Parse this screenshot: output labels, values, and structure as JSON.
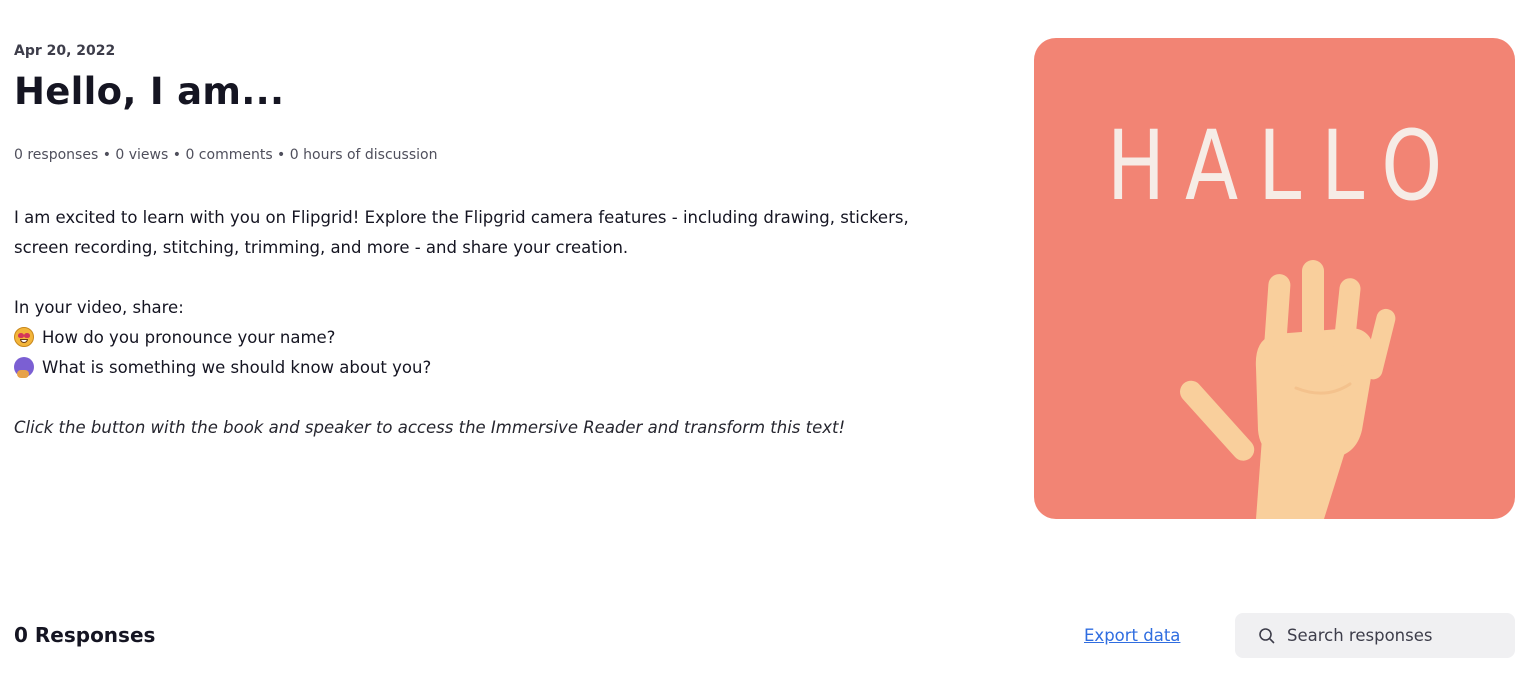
{
  "topic": {
    "date": "Apr 20, 2022",
    "title": "Hello, I am...",
    "stats": "0 responses • 0 views • 0 comments • 0 hours of discussion",
    "description": {
      "paragraph1": "I am excited to learn with you on Flipgrid! Explore the Flipgrid camera features - including drawing, stickers, screen recording, stitching, trimming, and more - and share your creation.",
      "share_intro": "In your video, share:",
      "bullets": [
        {
          "icon": "star-struck-emoji-icon",
          "text": "How do you pronounce your name?"
        },
        {
          "icon": "brain-emoji-icon",
          "text": "What is something we should know about you?"
        }
      ],
      "note": "Click the button with the book and speaker to access the Immersive Reader and transform this text!"
    }
  },
  "hero_image": {
    "text": "HALLO",
    "icon": "waving-hand-icon",
    "background_color": "#f28474",
    "text_color": "#f6ece6",
    "hand_color": "#f9cf9c"
  },
  "responses": {
    "title": "0 Responses",
    "export_label": "Export data",
    "search_placeholder": "Search responses",
    "search_value": ""
  },
  "colors": {
    "link": "#2f6de0",
    "search_background": "#f0f0f2",
    "title_text": "#151522"
  }
}
